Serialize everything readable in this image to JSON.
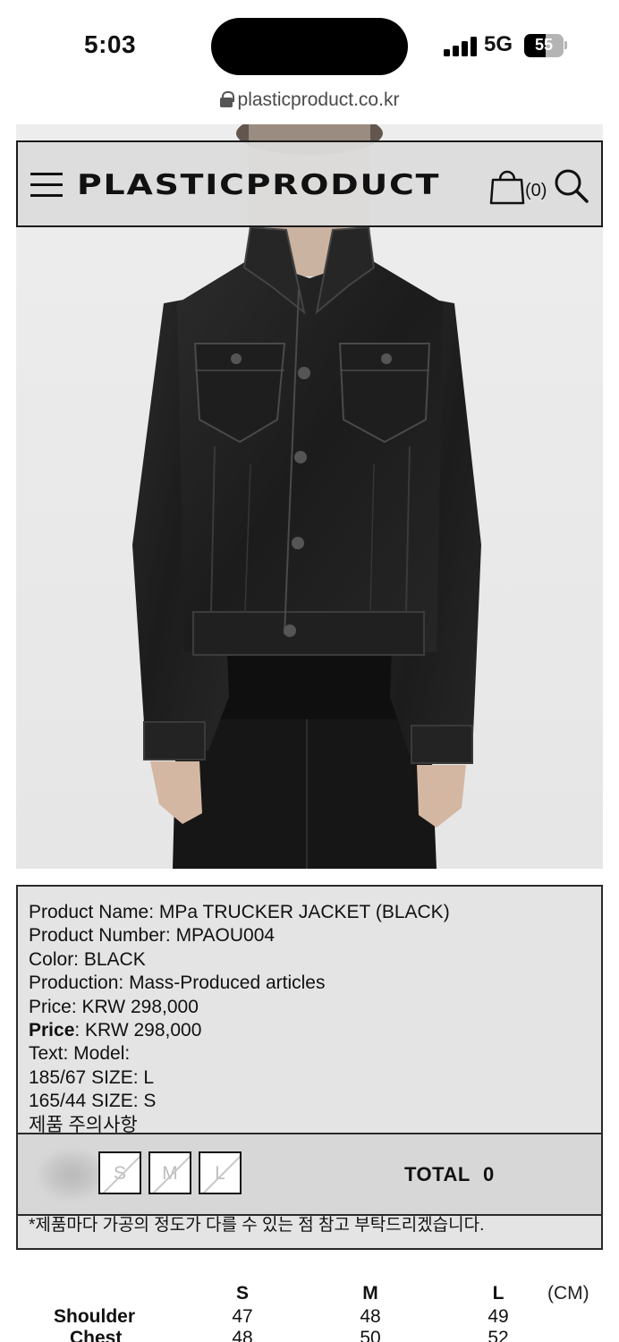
{
  "status_bar": {
    "time": "5:03",
    "network": "5G",
    "battery": "55",
    "battery_level": 0.55
  },
  "browser": {
    "domain": "plasticproduct.co.kr"
  },
  "header": {
    "logo": "PLASTICPRODUCT",
    "cart_count": "(0)",
    "icons": [
      "hamburger-menu-icon",
      "shopping-bag-icon",
      "search-icon"
    ]
  },
  "product": {
    "lines": [
      "Product Name: MPa TRUCKER JACKET (BLACK)",
      "Product Number: MPAOU004",
      "Color: BLACK",
      "Production: Mass-Produced articles",
      "Price: KRW 298,000"
    ],
    "price_label": "Price",
    "price_value": ": KRW 298,000",
    "lines2": [
      "Text: Model:",
      "185/67 SIZE: L",
      "165/44 SIZE: S",
      "제품 주의사항"
    ],
    "notice": "*제품마다 가공의 정도가 다를 수 있는 점 참고 부탁드리겠습니다."
  },
  "size_selector": {
    "options": [
      "S",
      "M",
      "L"
    ],
    "total_label": "TOTAL",
    "total_value": "0"
  },
  "size_chart": {
    "unit": "(CM)",
    "columns": [
      "S",
      "M",
      "L"
    ],
    "rows": [
      {
        "label": "Shoulder",
        "values": [
          "47",
          "48",
          "49"
        ]
      },
      {
        "label": "Chest",
        "values": [
          "48",
          "50",
          "52"
        ]
      }
    ]
  },
  "colors": {
    "jacket": "#1f1f1f",
    "background": "#ededed",
    "overlay": "#dcdcdc"
  }
}
